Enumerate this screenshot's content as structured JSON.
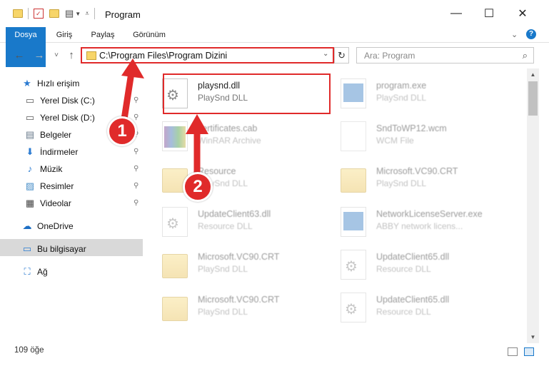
{
  "window": {
    "title": "Program",
    "minimize_glyph": "—",
    "maximize_glyph": "☐",
    "close_glyph": "✕"
  },
  "ribbon": {
    "tabs": [
      "Dosya",
      "Giriş",
      "Paylaş",
      "Görünüm"
    ],
    "help_glyph": "?"
  },
  "address": {
    "path": "C:\\Program Files\\Program Dizini",
    "dropdown_glyph": "⌄",
    "refresh_glyph": "↻"
  },
  "search": {
    "placeholder": "Ara: Program",
    "icon_glyph": "⌕"
  },
  "nav": {
    "back_glyph": "←",
    "forward_glyph": "→",
    "history_glyph": "˅",
    "up_glyph": "↑"
  },
  "sidebar": {
    "items": [
      {
        "label": "Hızlı erişim",
        "icon": "star-icon",
        "glyph": "★",
        "color": "#2b7bd1"
      },
      {
        "label": "Yerel Disk (C:)",
        "icon": "drive-icon",
        "glyph": "▭",
        "color": "#5b5b5b"
      },
      {
        "label": "Yerel Disk (D:)",
        "icon": "drive-icon",
        "glyph": "▭",
        "color": "#5b5b5b"
      },
      {
        "label": "Belgeler",
        "icon": "documents-icon",
        "glyph": "▤",
        "color": "#6a7b8c"
      },
      {
        "label": "İndirmeler",
        "icon": "download-icon",
        "glyph": "⬇",
        "color": "#2b7bd1"
      },
      {
        "label": "Müzik",
        "icon": "music-icon",
        "glyph": "♪",
        "color": "#2b7bd1"
      },
      {
        "label": "Resimler",
        "icon": "pictures-icon",
        "glyph": "▨",
        "color": "#4a8fc8"
      },
      {
        "label": "Videolar",
        "icon": "videos-icon",
        "glyph": "▦",
        "color": "#444"
      },
      {
        "label": "OneDrive",
        "icon": "cloud-icon",
        "glyph": "☁",
        "color": "#1d6fc4"
      },
      {
        "label": "Bu bilgisayar",
        "icon": "computer-icon",
        "glyph": "▭",
        "color": "#2b7bd1"
      },
      {
        "label": "Ağ",
        "icon": "network-icon",
        "glyph": "⛶",
        "color": "#2b7bd1"
      }
    ],
    "pin_glyph": "📌"
  },
  "files": [
    {
      "name": "playsnd.dll",
      "type": "PlaySnd DLL",
      "kind": "dll"
    },
    {
      "name": "program.exe",
      "type": "PlaySnd DLL",
      "kind": "exe"
    },
    {
      "name": "certificates.cab",
      "type": "WinRAR Archive",
      "kind": "archive"
    },
    {
      "name": "SndToWP12.wcm",
      "type": "WCM File",
      "kind": "doc"
    },
    {
      "name": "Resource",
      "type": "PlaySnd DLL",
      "kind": "folder"
    },
    {
      "name": "Microsoft.VC90.CRT",
      "type": "PlaySnd DLL",
      "kind": "folder"
    },
    {
      "name": "UpdateClient63.dll",
      "type": "Resource DLL",
      "kind": "dll"
    },
    {
      "name": "NetworkLicenseServer.exe",
      "type": "ABBY network licens...",
      "kind": "exe"
    },
    {
      "name": "Microsoft.VC90.CRT",
      "type": "PlaySnd DLL",
      "kind": "folder"
    },
    {
      "name": "UpdateClient65.dll",
      "type": "Resource DLL",
      "kind": "dll"
    },
    {
      "name": "Microsoft.VC90.CRT",
      "type": "PlaySnd DLL",
      "kind": "folder"
    },
    {
      "name": "UpdateClient65.dll",
      "type": "Resource DLL",
      "kind": "dll"
    }
  ],
  "status": {
    "item_count": "109 öğe"
  },
  "callouts": [
    "1",
    "2"
  ],
  "colors": {
    "accent": "#1979ca",
    "highlight": "#e02a2a",
    "folder": "#f7d569"
  }
}
